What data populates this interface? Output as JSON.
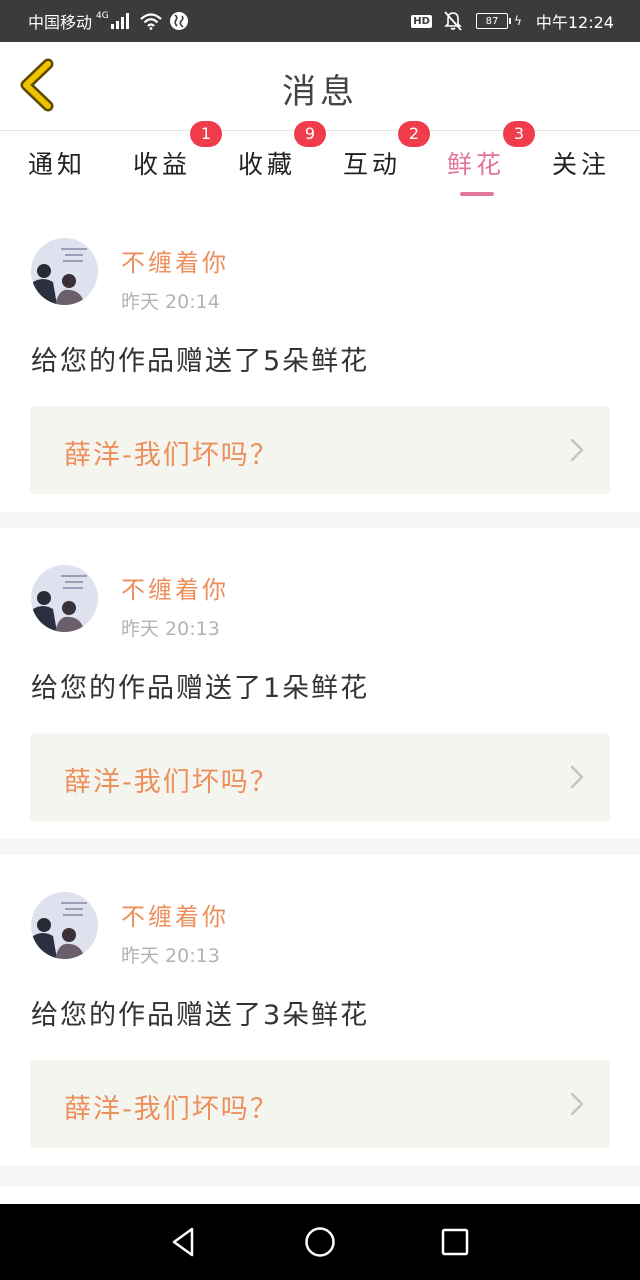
{
  "status_bar": {
    "carrier": "中国移动",
    "network": "4G",
    "hd": "HD",
    "battery": "87",
    "time": "中午12:24"
  },
  "header": {
    "title": "消息"
  },
  "tabs": [
    {
      "label": "通知",
      "badge": ""
    },
    {
      "label": "收益",
      "badge": "1"
    },
    {
      "label": "收藏",
      "badge": "9"
    },
    {
      "label": "互动",
      "badge": "2"
    },
    {
      "label": "鲜花",
      "badge": "3",
      "active": true
    },
    {
      "label": "关注",
      "badge": ""
    }
  ],
  "feed": [
    {
      "user": "不缠着你",
      "time": "昨天 20:14",
      "message": "给您的作品赠送了5朵鲜花",
      "work": "薛洋-我们坏吗？"
    },
    {
      "user": "不缠着你",
      "time": "昨天 20:13",
      "message": "给您的作品赠送了1朵鲜花",
      "work": "薛洋-我们坏吗？"
    },
    {
      "user": "不缠着你",
      "time": "昨天 20:13",
      "message": "给您的作品赠送了3朵鲜花",
      "work": "薛洋-我们坏吗？"
    }
  ],
  "colors": {
    "accent": "#e3749d",
    "username": "#ec8f5d",
    "badge": "#f13d4b",
    "back_arrow": "#f0c200"
  },
  "icons": [
    "back-arrow-icon",
    "chevron-right-icon",
    "nav-back-icon",
    "nav-home-icon",
    "nav-recents-icon"
  ]
}
